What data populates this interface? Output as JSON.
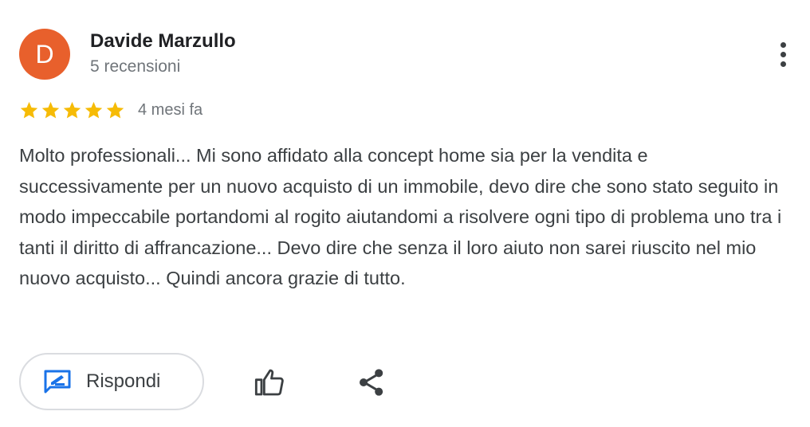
{
  "review": {
    "author": {
      "initial": "D",
      "name": "Davide Marzullo",
      "meta": "5 recensioni",
      "avatar_color": "#e8602c"
    },
    "rating": 5,
    "rating_max": 5,
    "star_color": "#f6bb06",
    "date": "4 mesi fa",
    "text": "Molto professionali... Mi sono affidato alla concept home sia per la vendita e successivamente per un nuovo acquisto di un immobile, devo dire che sono stato seguito in modo impeccabile portandomi al rogito aiutandomi a risolvere ogni tipo di problema uno tra i tanti il diritto di affrancazione... Devo dire che senza il loro aiuto non sarei riuscito nel mio nuovo acquisto... Quindi ancora grazie di tutto."
  },
  "actions": {
    "reply_label": "Rispondi",
    "reply_icon": "rate-review-icon",
    "reply_icon_color": "#1a73e8",
    "like_icon": "thumb-up-icon",
    "share_icon": "share-icon",
    "more_icon": "more-vert-icon"
  }
}
